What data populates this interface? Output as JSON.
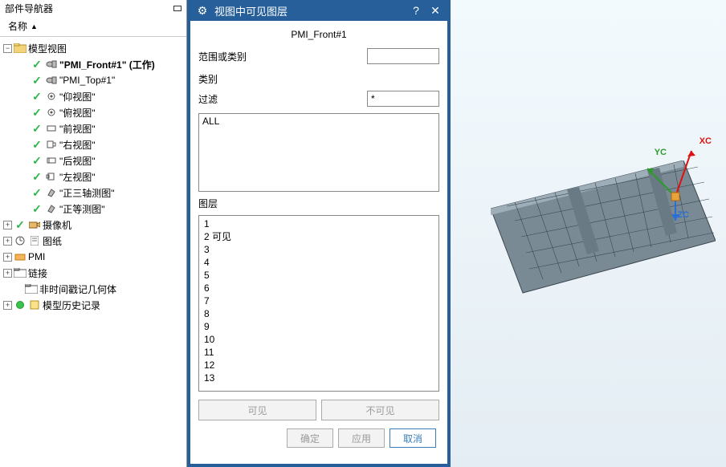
{
  "tree": {
    "panel_title": "部件导航器",
    "column_header": "名称",
    "root": "模型视图",
    "views": [
      {
        "label": "\"PMI_Front#1\" (工作)",
        "bold": true
      },
      {
        "label": "\"PMI_Top#1\""
      },
      {
        "label": "\"仰视图\""
      },
      {
        "label": "\"俯视图\""
      },
      {
        "label": "\"前视图\""
      },
      {
        "label": "\"右视图\""
      },
      {
        "label": "\"后视图\""
      },
      {
        "label": "\"左视图\""
      },
      {
        "label": "\"正三轴测图\""
      },
      {
        "label": "\"正等测图\""
      }
    ],
    "camera": "摄像机",
    "drawing": "图纸",
    "pmi": "PMI",
    "link": "链接",
    "non_ts_geom": "非时间戳记几何体",
    "history": "模型历史记录"
  },
  "dialog": {
    "title": "视图中可见图层",
    "current_view": "PMI_Front#1",
    "range_label": "范围或类别",
    "range_value": "",
    "category_label": "类别",
    "filter_label": "过滤",
    "filter_value": "*",
    "textarea_value": "ALL",
    "layers_label": "图层",
    "layers": [
      "1",
      "2 可见",
      "3",
      "4",
      "5",
      "6",
      "7",
      "8",
      "9",
      "10",
      "11",
      "12",
      "13"
    ],
    "btn_visible": "可见",
    "btn_invisible": "不可见",
    "btn_ok": "确定",
    "btn_apply": "应用",
    "btn_cancel": "取消"
  },
  "viewport": {
    "xc": "XC",
    "yc": "YC",
    "zc": "ZC"
  }
}
